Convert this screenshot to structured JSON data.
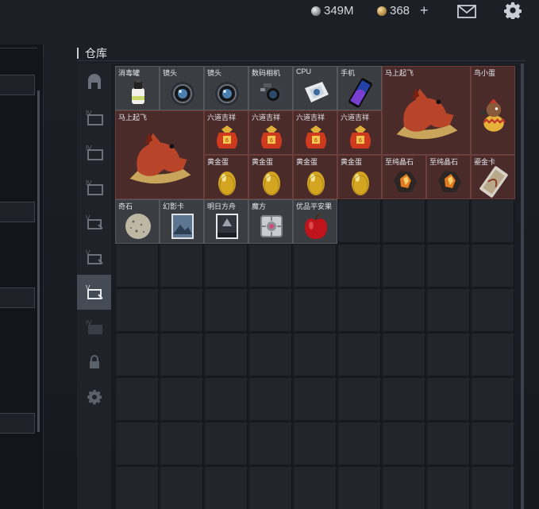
{
  "currency": {
    "silver": "349M",
    "gold": "368",
    "plus": "+"
  },
  "warehouse": {
    "title": "仓库"
  },
  "items": [
    {
      "label": "消毒罐",
      "icon": "disinfectant-can-icon"
    },
    {
      "label": "镜头",
      "icon": "camera-lens-icon"
    },
    {
      "label": "镜头",
      "icon": "camera-lens-icon"
    },
    {
      "label": "数码相机",
      "icon": "digital-camera-icon"
    },
    {
      "label": "CPU",
      "icon": "cpu-chip-icon"
    },
    {
      "label": "手机",
      "icon": "smartphone-icon"
    },
    {
      "label": "马上起飞",
      "icon": "horse-carpet-icon"
    },
    {
      "label": "鸟小蛋",
      "icon": "bird-egg-figure-icon"
    },
    {
      "label": "马上起飞",
      "icon": "horse-carpet-icon"
    },
    {
      "label": "六道吉祥",
      "icon": "lucky-bag-icon"
    },
    {
      "label": "六道吉祥",
      "icon": "lucky-bag-icon"
    },
    {
      "label": "六道吉祥",
      "icon": "lucky-bag-icon"
    },
    {
      "label": "六道吉祥",
      "icon": "lucky-bag-icon"
    },
    {
      "label": "黄金蛋",
      "icon": "golden-egg-icon"
    },
    {
      "label": "黄金蛋",
      "icon": "golden-egg-icon"
    },
    {
      "label": "黄金蛋",
      "icon": "golden-egg-icon"
    },
    {
      "label": "黄金蛋",
      "icon": "golden-egg-icon"
    },
    {
      "label": "至纯晶石",
      "icon": "crystal-ore-icon"
    },
    {
      "label": "至纯晶石",
      "icon": "crystal-ore-icon"
    },
    {
      "label": "鎏金卡",
      "icon": "gilded-card-icon"
    },
    {
      "label": "奇石",
      "icon": "stone-sphere-icon"
    },
    {
      "label": "幻影卡",
      "icon": "photo-card-icon"
    },
    {
      "label": "明日方舟",
      "icon": "game-box-icon"
    },
    {
      "label": "魔方",
      "icon": "companion-cube-icon"
    },
    {
      "label": "优品平安果",
      "icon": "red-apple-icon"
    }
  ]
}
